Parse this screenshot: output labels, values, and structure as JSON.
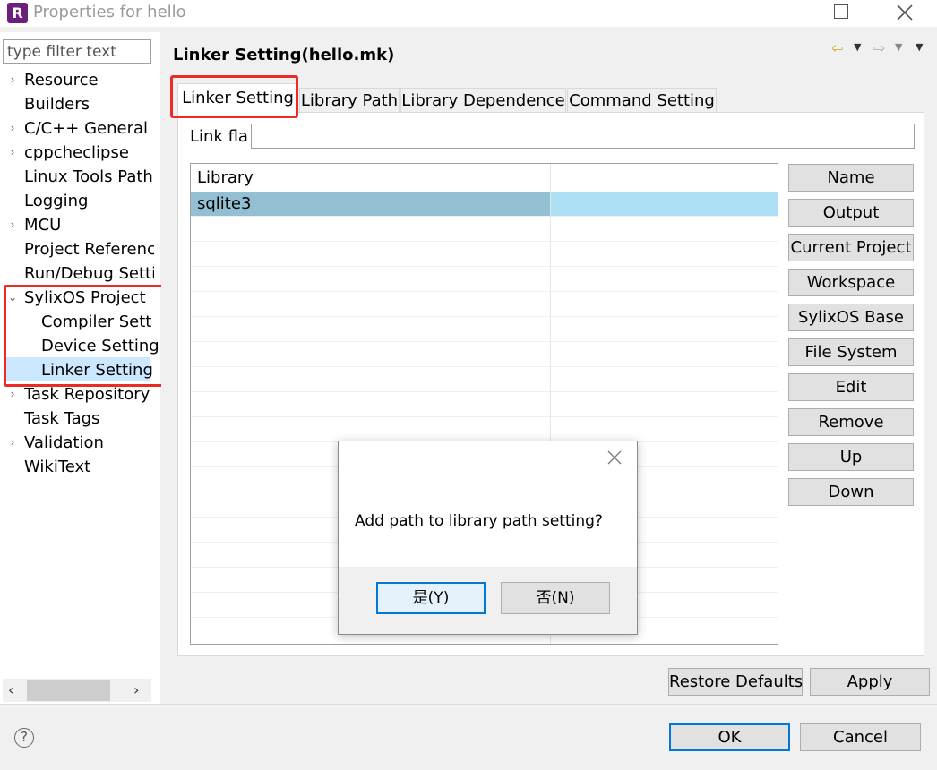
{
  "window": {
    "title": "Properties for hello",
    "logo_letter": "R"
  },
  "left": {
    "filter_placeholder": "type filter text",
    "tree": [
      {
        "label": "Resource",
        "arrow": "›"
      },
      {
        "label": "Builders",
        "arrow": ""
      },
      {
        "label": "C/C++ General",
        "arrow": "›"
      },
      {
        "label": "cppcheclipse",
        "arrow": "›"
      },
      {
        "label": "Linux Tools Path",
        "arrow": ""
      },
      {
        "label": "Logging",
        "arrow": ""
      },
      {
        "label": "MCU",
        "arrow": "›"
      },
      {
        "label": "Project Reference",
        "arrow": ""
      },
      {
        "label": "Run/Debug Setti",
        "arrow": ""
      },
      {
        "label": "SylixOS Project",
        "arrow": "⌄"
      },
      {
        "label": "Compiler Setti",
        "arrow": ""
      },
      {
        "label": "Device Setting",
        "arrow": ""
      },
      {
        "label": "Linker Setting",
        "arrow": ""
      },
      {
        "label": "Task Repository",
        "arrow": "›"
      },
      {
        "label": "Task Tags",
        "arrow": ""
      },
      {
        "label": "Validation",
        "arrow": "›"
      },
      {
        "label": "WikiText",
        "arrow": ""
      }
    ],
    "scroll_left": "‹",
    "scroll_right": "›"
  },
  "main": {
    "title": "Linker Setting(hello.mk)",
    "tabs": [
      "Linker Setting",
      "Library Path",
      "Library Dependence",
      "Command Setting"
    ],
    "link_flags_label": "Link flags",
    "link_flags_value": "",
    "table": {
      "headers": [
        "Library",
        ""
      ],
      "rows": [
        [
          "sqlite3",
          ""
        ]
      ]
    },
    "side_buttons": [
      "Name",
      "Output",
      "Current Project",
      "Workspace",
      "SylixOS Base",
      "File System",
      "Edit",
      "Remove",
      "Up",
      "Down"
    ],
    "restore_defaults": "Restore Defaults",
    "apply": "Apply"
  },
  "footer": {
    "help": "?",
    "ok": "OK",
    "cancel": "Cancel"
  },
  "dialog": {
    "message": "Add path to library path setting?",
    "yes": "是(Y)",
    "no": "否(N)"
  },
  "colors": {
    "highlight_box": "#ee2a24",
    "selection": "#cce8ff",
    "row_selected": "#93bfd3",
    "dialog_default_border": "#0078d7"
  }
}
